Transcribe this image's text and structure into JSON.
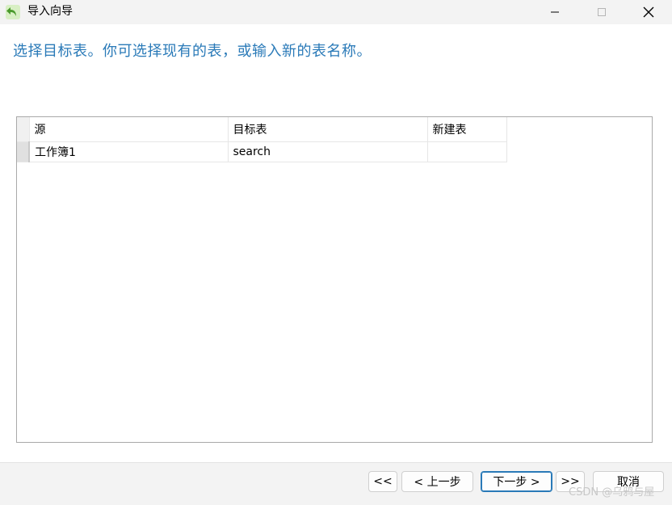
{
  "window": {
    "title": "导入向导"
  },
  "instruction": "选择目标表。你可选择现有的表，或输入新的表名称。",
  "grid": {
    "columns": [
      "源",
      "目标表",
      "新建表"
    ],
    "rows": [
      {
        "source": "工作簿1",
        "target": "search",
        "new_table": ""
      }
    ]
  },
  "buttons": {
    "first": "<<",
    "prev": "< 上一步",
    "next": "下一步 >",
    "last": ">>",
    "cancel": "取消"
  },
  "watermark": "CSDN @乌鸦与屋",
  "colors": {
    "accent": "#2a7ab8",
    "titlebar": "#f3f3f3",
    "footer": "#f3f3f3"
  }
}
